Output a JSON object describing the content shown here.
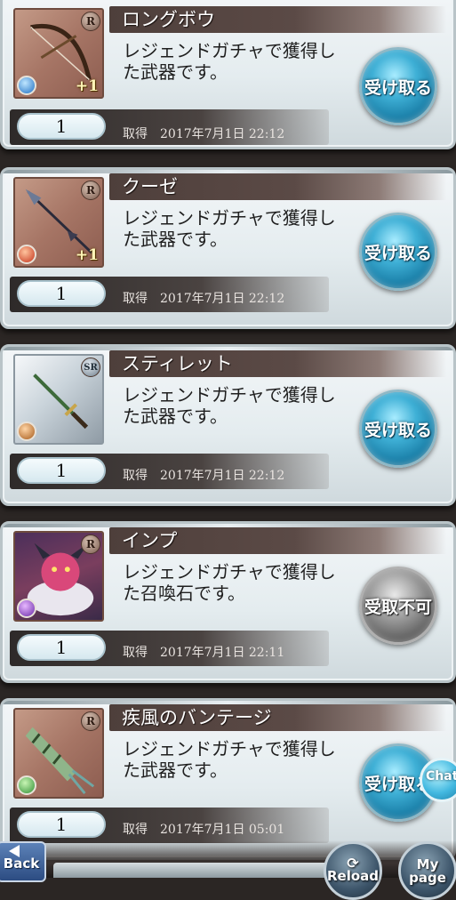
{
  "items": [
    {
      "name": "ロングボウ",
      "rarity": "R",
      "element": "water",
      "plus": "+1",
      "description_line1": "レジェンドガチャで獲得し",
      "description_line2": "た武器です。",
      "quantity": "1",
      "obtained_label": "取得",
      "obtained_date": "2017年7月1日 22:12",
      "button_label": "受け取る",
      "button_state": "enabled"
    },
    {
      "name": "クーゼ",
      "rarity": "R",
      "element": "fire",
      "plus": "+1",
      "description_line1": "レジェンドガチャで獲得し",
      "description_line2": "た武器です。",
      "quantity": "1",
      "obtained_label": "取得",
      "obtained_date": "2017年7月1日 22:12",
      "button_label": "受け取る",
      "button_state": "enabled"
    },
    {
      "name": "スティレット",
      "rarity": "SR",
      "element": "earth",
      "plus": "",
      "description_line1": "レジェンドガチャで獲得し",
      "description_line2": "た武器です。",
      "quantity": "1",
      "obtained_label": "取得",
      "obtained_date": "2017年7月1日 22:12",
      "button_label": "受け取る",
      "button_state": "enabled"
    },
    {
      "name": "インプ",
      "rarity": "R",
      "element": "dark",
      "plus": "",
      "description_line1": "レジェンドガチャで獲得し",
      "description_line2": "た召喚石です。",
      "quantity": "1",
      "obtained_label": "取得",
      "obtained_date": "2017年7月1日 22:11",
      "button_label": "受取不可",
      "button_state": "disabled"
    },
    {
      "name": "疾風のバンテージ",
      "rarity": "R",
      "element": "wind",
      "plus": "",
      "description_line1": "レジェンドガチャで獲得し",
      "description_line2": "た武器です。",
      "quantity": "1",
      "obtained_label": "取得",
      "obtained_date": "2017年7月1日 05:01",
      "button_label": "受け取る",
      "button_state": "enabled"
    }
  ],
  "footer": {
    "back_label": "Back",
    "reload_label": "Reload",
    "mypage_label": "My page",
    "chat_label": "Chat"
  }
}
